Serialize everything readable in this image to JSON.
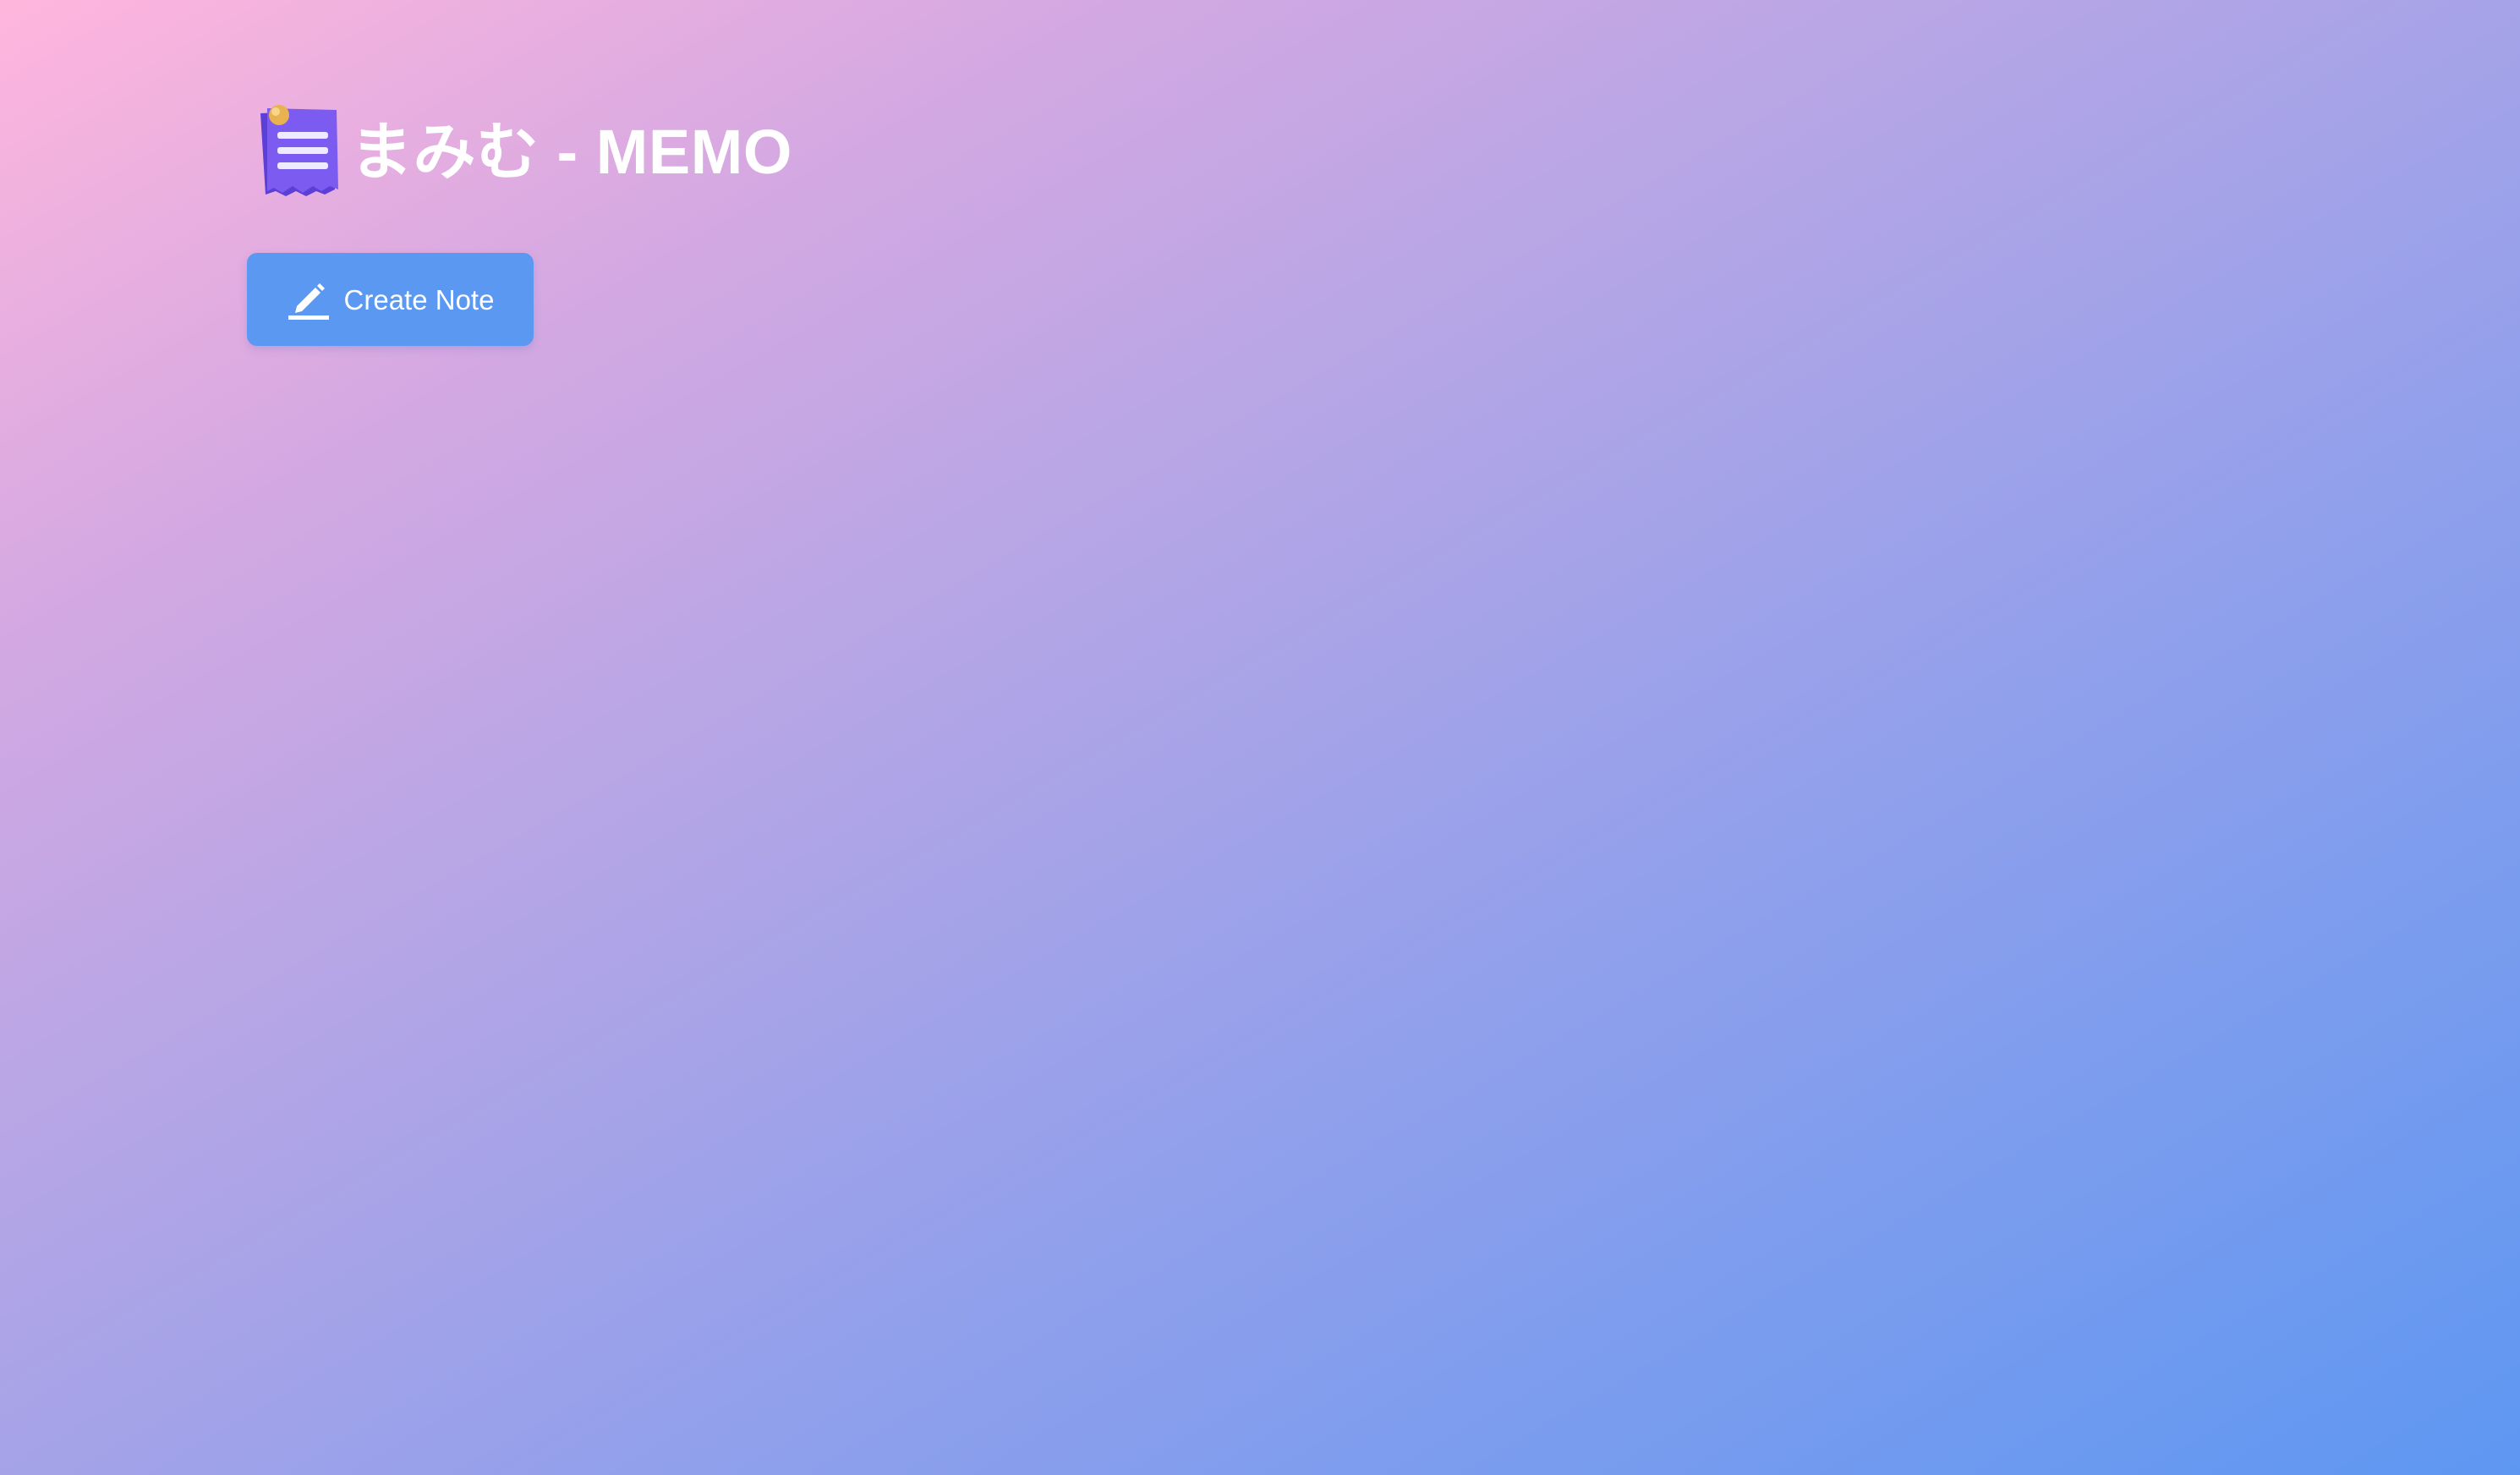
{
  "app": {
    "title": "まみむ - MEMO",
    "logo_icon": "memo-note-icon"
  },
  "toolbar": {
    "create_note_label": "Create Note",
    "create_note_icon": "pencil-icon"
  },
  "colors": {
    "gradient_start": "#ffb6dd",
    "gradient_end": "#5e97f2",
    "button_bg": "#5a98f1",
    "text": "#ffffff",
    "logo_purple": "#7c5cf0"
  }
}
